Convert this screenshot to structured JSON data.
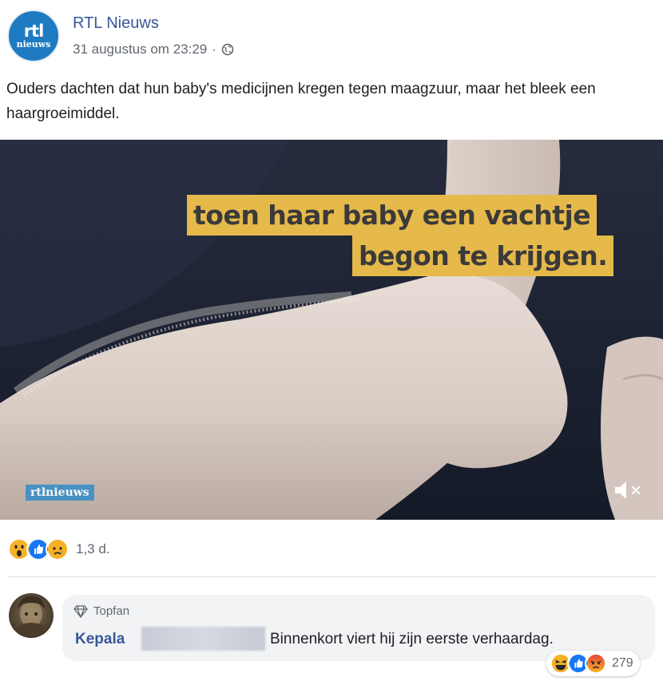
{
  "post": {
    "page_name": "RTL Nieuws",
    "logo_text_top": "rtl",
    "logo_text_bottom": "nieuws",
    "timestamp": "31 augustus om 23:29",
    "separator": "·",
    "audience_icon": "globe-icon",
    "text": "Ouders dachten dat hun baby's medicijnen kregen tegen maagzuur, maar het bleek een haargroeimiddel."
  },
  "video": {
    "caption_line1": "toen haar baby een vachtje",
    "caption_line2": "begon te krijgen.",
    "watermark": "rtlnieuws",
    "mute_icon": "speaker-muted-icon"
  },
  "reactions": {
    "icons": [
      "wow-emoji-icon",
      "like-icon",
      "sad-emoji-icon"
    ],
    "count": "1,3 d."
  },
  "comment": {
    "badge": "Topfan",
    "badge_icon": "diamond-icon",
    "author": "Kepala",
    "text": "Binnenkort viert hij zijn eerste verhaardag.",
    "reaction_icons": [
      "haha-emoji-icon",
      "like-icon",
      "angry-emoji-icon"
    ],
    "reaction_count": "279"
  },
  "colors": {
    "link_blue": "#385898",
    "caption_yellow": "#e5b94a",
    "rtl_blue": "#1f7bc1",
    "like_blue": "#1877f2"
  }
}
